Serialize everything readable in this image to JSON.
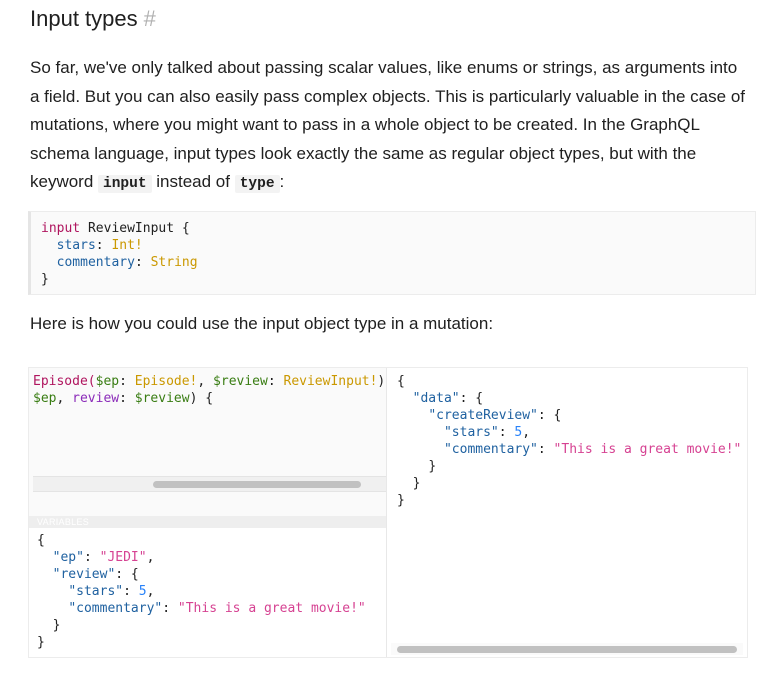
{
  "heading": {
    "title": "Input types",
    "anchor": "#"
  },
  "intro": {
    "part1": "So far, we've only talked about passing scalar values, like enums or strings, as arguments into a field. But you can also easily pass complex objects. This is particularly valuable in the case of mutations, where you might want to pass in a whole object to be created. In the GraphQL schema language, input types look exactly the same as regular object types, but with the keyword ",
    "code1": "input",
    "part2": " instead of ",
    "code2": "type",
    "part3": ":"
  },
  "schema_code": {
    "kw_input": "input",
    "type_name": " ReviewInput {",
    "field1": "stars",
    "type1": "Int!",
    "field2": "commentary",
    "type2": "String",
    "close": "}"
  },
  "usage_text": "Here is how you could use the input object type in a mutation:",
  "query": {
    "line1_name": "Episode(",
    "line1_var1": "$ep",
    "line1_sep1": ": ",
    "line1_type1": "Episode!",
    "line1_sep2": ", ",
    "line1_var2": "$review",
    "line1_sep3": ": ",
    "line1_type2": "ReviewInput!",
    "line1_end": ")",
    "line2_var1": "$ep",
    "line2_mid": ", ",
    "line2_arg": "review",
    "line2_sep": ": ",
    "line2_var2": "$review",
    "line2_end": ") {"
  },
  "variables_label": "VARIABLES",
  "variables": {
    "open": "{",
    "k_ep": "\"ep\"",
    "v_ep": "\"JEDI\"",
    "k_review": "\"review\"",
    "k_stars": "\"stars\"",
    "v_stars": "5",
    "k_comm": "\"commentary\"",
    "v_comm": "\"This is a great movie!\"",
    "close_inner": "}",
    "close": "}"
  },
  "result": {
    "open": "{",
    "k_data": "\"data\"",
    "k_create": "\"createReview\"",
    "k_stars": "\"stars\"",
    "v_stars": "5",
    "k_comm": "\"commentary\"",
    "v_comm": "\"This is a great movie!\"",
    "close": "}"
  },
  "colors": {
    "keyword": "#b0155f",
    "field": "#1f61a0",
    "type": "#ca9800",
    "string": "#d64292",
    "number": "#2882f9",
    "variable": "#397d13"
  }
}
